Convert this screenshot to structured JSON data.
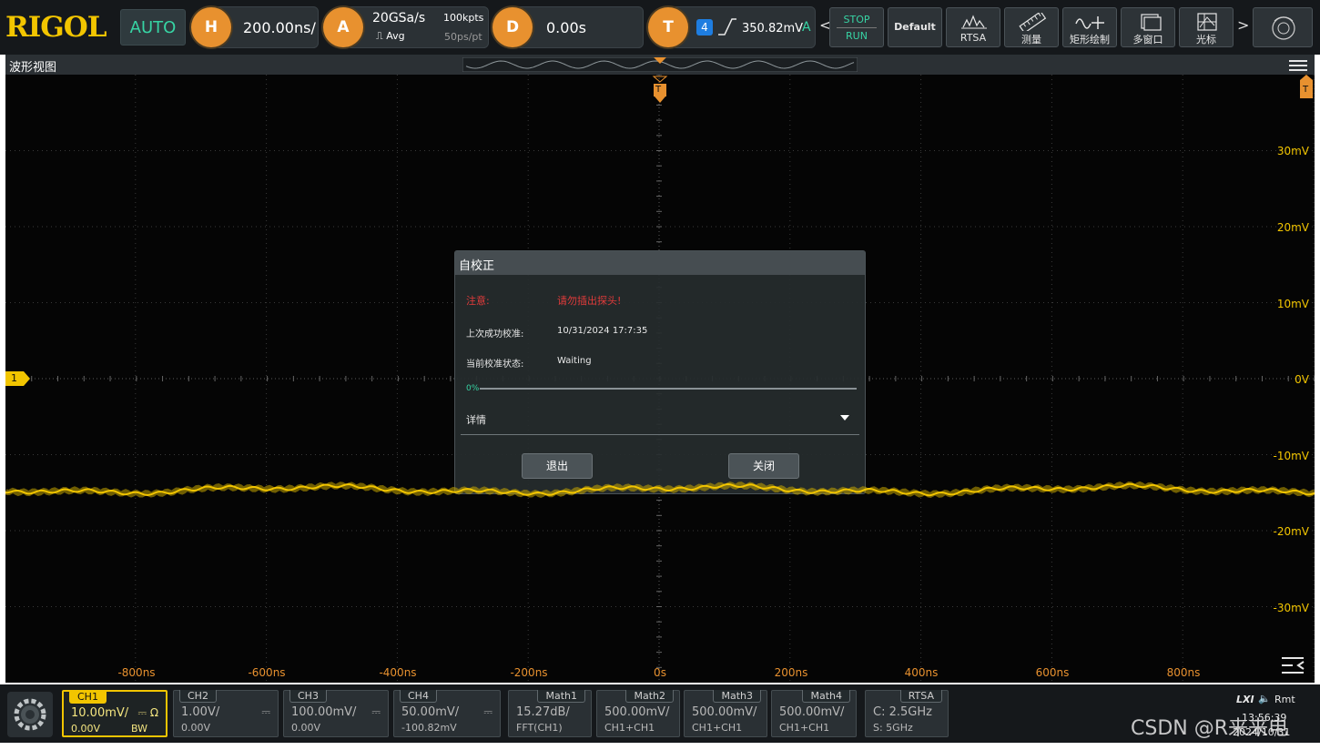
{
  "brand": "RIGOL",
  "toolbar": {
    "auto_label": "AUTO",
    "horizontal": {
      "badge": "H",
      "value": "200.00ns/"
    },
    "acquire": {
      "badge": "A",
      "rate": "20GSa/s",
      "mode": "Avg",
      "depth": "100kpts",
      "per_pt": "50ps/pt"
    },
    "delay": {
      "badge": "D",
      "value": "0.00s"
    },
    "trigger": {
      "badge": "T",
      "source": "4",
      "level": "350.82mV",
      "mode": "A"
    },
    "stop_label": "STOP",
    "run_label": "RUN",
    "default_label": "Default",
    "rtsa_label": "RTSA",
    "measure_label": "测量",
    "zone_label": "矩形绘制",
    "multiwin_label": "多窗口",
    "cursor_label": "光标",
    "left_chevron": "<",
    "right_chevron": ">"
  },
  "waveform_view": {
    "title": "波形视图",
    "trigger_marker": "T",
    "channel_marker": "1",
    "volt_labels": [
      "30mV",
      "20mV",
      "10mV",
      "0V",
      "-10mV",
      "-20mV",
      "-30mV"
    ],
    "time_labels": [
      "-800ns",
      "-600ns",
      "-400ns",
      "-200ns",
      "0s",
      "200ns",
      "400ns",
      "600ns",
      "800ns"
    ]
  },
  "dialog": {
    "title": "自校正",
    "notice_label": "注意:",
    "notice_text": "请勿插出探头!",
    "last_label": "上次成功校准:",
    "last_value": "10/31/2024 17:7:35",
    "status_label": "当前校准状态:",
    "status_value": "Waiting",
    "progress_label": "0%",
    "progress": 0,
    "details_label": "详情",
    "exit_label": "退出",
    "close_label": "关闭"
  },
  "channels": [
    {
      "tag": "CH1",
      "line1": "10.00mV/",
      "sym": "⎓ Ω",
      "line2": "0.00V",
      "extra": "BW"
    },
    {
      "tag": "CH2",
      "line1": "1.00V/",
      "sym": "⎓",
      "line2": "0.00V"
    },
    {
      "tag": "CH3",
      "line1": "100.00mV/",
      "sym": "⎓",
      "line2": "0.00V"
    },
    {
      "tag": "CH4",
      "line1": "50.00mV/",
      "sym": "⎓",
      "line2": "-100.82mV"
    }
  ],
  "maths": [
    {
      "tag": "Math1",
      "line1": "15.27dB/",
      "line2": "FFT(CH1)"
    },
    {
      "tag": "Math2",
      "line1": "500.00mV/",
      "line2": "CH1+CH1"
    },
    {
      "tag": "Math3",
      "line1": "500.00mV/",
      "line2": "CH1+CH1"
    },
    {
      "tag": "Math4",
      "line1": "500.00mV/",
      "line2": "CH1+CH1"
    }
  ],
  "rtsa": {
    "tag": "RTSA",
    "line1": "C: 2.5GHz",
    "line2": "S: 5GHz"
  },
  "status_bar": {
    "lxi": "LXI",
    "rmt": "Rmt",
    "time": "13:56:39",
    "date": "2024/10/31"
  },
  "watermark": "CSDN @R来来电",
  "colors": {
    "ch1": "#f2c500",
    "trigger": "#e8912f",
    "auto": "#37d4a4",
    "notice": "#e03b3b",
    "trig_source": "#1e7de0"
  }
}
